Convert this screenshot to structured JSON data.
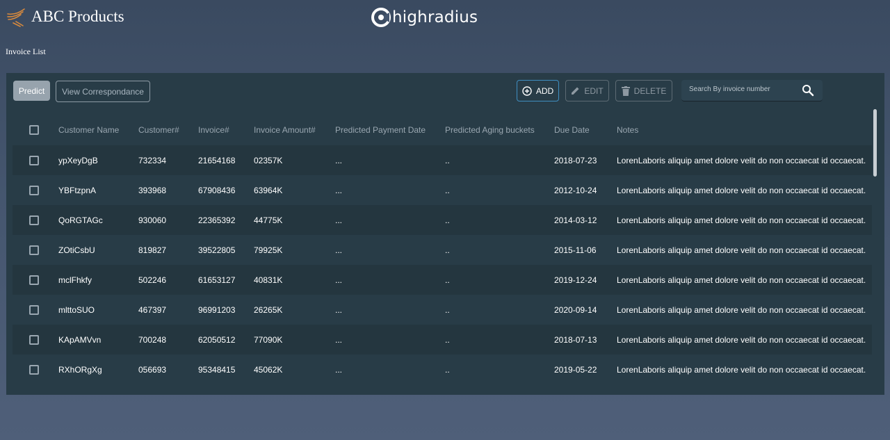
{
  "brand": {
    "name": "ABC Products",
    "logo_icon": "abc-wing-logo-icon"
  },
  "partner_logo": {
    "text": "highradius",
    "icon": "highradius-logo-icon"
  },
  "page_title": "Invoice List",
  "toolbar": {
    "predict_label": "Predict",
    "view_correspondance_label": "View Correspondance",
    "add_label": "ADD",
    "edit_label": "EDIT",
    "delete_label": "DELETE"
  },
  "search": {
    "placeholder": "Search By invoice number",
    "value": ""
  },
  "table": {
    "columns": [
      "Customer Name",
      "Customer#",
      "Invoice#",
      "Invoice Amount#",
      "Predicted Payment Date",
      "Predicted Aging buckets",
      "Due Date",
      "Notes"
    ],
    "rows": [
      {
        "name": "ypXeyDgB",
        "customer": "732334",
        "invoice": "21654168",
        "amount": "02357K",
        "ppd": "...",
        "pab": "..",
        "due": "2018-07-23",
        "notes": "LorenLaboris aliquip amet dolore velit do non occaecat id occaecat."
      },
      {
        "name": "YBFtzpnA",
        "customer": "393968",
        "invoice": "67908436",
        "amount": "63964K",
        "ppd": "...",
        "pab": "..",
        "due": "2012-10-24",
        "notes": "LorenLaboris aliquip amet dolore velit do non occaecat id occaecat."
      },
      {
        "name": "QoRGTAGc",
        "customer": "930060",
        "invoice": "22365392",
        "amount": "44775K",
        "ppd": "...",
        "pab": "..",
        "due": "2014-03-12",
        "notes": "LorenLaboris aliquip amet dolore velit do non occaecat id occaecat."
      },
      {
        "name": "ZOtiCsbU",
        "customer": "819827",
        "invoice": "39522805",
        "amount": "79925K",
        "ppd": "...",
        "pab": "..",
        "due": "2015-11-06",
        "notes": "LorenLaboris aliquip amet dolore velit do non occaecat id occaecat."
      },
      {
        "name": "mclFhkfy",
        "customer": "502246",
        "invoice": "61653127",
        "amount": "40831K",
        "ppd": "...",
        "pab": "..",
        "due": "2019-12-24",
        "notes": "LorenLaboris aliquip amet dolore velit do non occaecat id occaecat."
      },
      {
        "name": "mlttoSUO",
        "customer": "467397",
        "invoice": "96991203",
        "amount": "26265K",
        "ppd": "...",
        "pab": "..",
        "due": "2020-09-14",
        "notes": "LorenLaboris aliquip amet dolore velit do non occaecat id occaecat."
      },
      {
        "name": "KApAMVvn",
        "customer": "700248",
        "invoice": "62050512",
        "amount": "77090K",
        "ppd": "...",
        "pab": "..",
        "due": "2018-07-13",
        "notes": "LorenLaboris aliquip amet dolore velit do non occaecat id occaecat."
      },
      {
        "name": "RXhORgXg",
        "customer": "056693",
        "invoice": "95348415",
        "amount": "45062K",
        "ppd": "...",
        "pab": "..",
        "due": "2019-05-22",
        "notes": "LorenLaboris aliquip amet dolore velit do non occaecat id occaecat."
      }
    ]
  },
  "colors": {
    "background": "#45566f",
    "panel": "#283c47",
    "row_alt": "#24363f",
    "accent_border": "#3f8ec1",
    "logo_orange": "#d98a3d"
  }
}
